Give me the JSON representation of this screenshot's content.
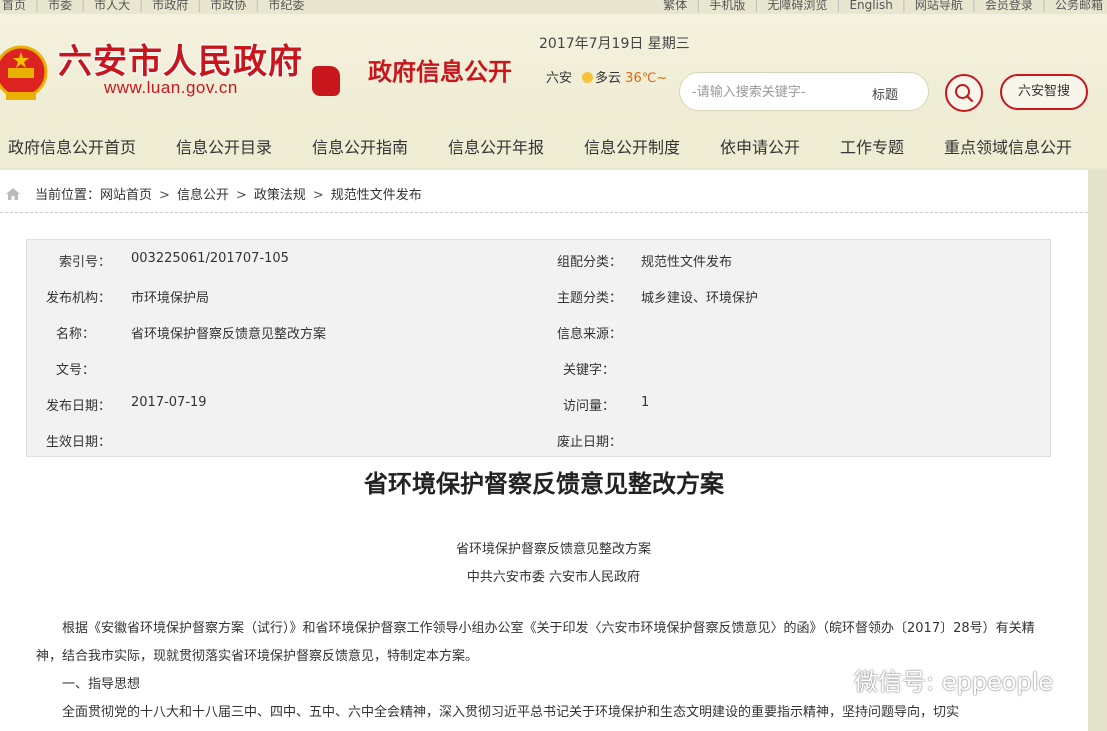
{
  "topbar": {
    "left_links": [
      "首页",
      "市委",
      "市人大",
      "市政府",
      "市政协",
      "市纪委"
    ],
    "right_links": [
      "繁体",
      "手机版",
      "无障碍浏览",
      "English",
      "网站导航",
      "会员登录",
      "公务邮箱"
    ]
  },
  "header": {
    "site_name": "六安市人民政府",
    "site_url": "www.luan.gov.cn",
    "channel_name": "政府信息公开",
    "date": "2017年7月19日 星期三",
    "weather": {
      "city": "六安",
      "condition": "多云",
      "temp": "36℃~"
    },
    "search": {
      "placeholder": "-请输入搜索关键字-",
      "scope": "标题"
    },
    "smart_search_label": "六安智搜"
  },
  "nav": {
    "items": [
      "政府信息公开首页",
      "信息公开目录",
      "信息公开指南",
      "信息公开年报",
      "信息公开制度",
      "依申请公开",
      "工作专题",
      "重点领域信息公开"
    ]
  },
  "breadcrumb": {
    "label": "当前位置：",
    "items": [
      "网站首页",
      "信息公开",
      "政策法规",
      "规范性文件发布"
    ],
    "sep": ">"
  },
  "meta": {
    "index_label": "索引号：",
    "index_value": "003225061/201707-105",
    "category_label": "组配分类：",
    "category_value": "规范性文件发布",
    "publisher_label": "发布机构：",
    "publisher_value": "市环境保护局",
    "topic_label": "主题分类：",
    "topic_value": "城乡建设、环境保护",
    "name_label": "名称：",
    "name_value": "省环境保护督察反馈意见整改方案",
    "source_label": "信息来源：",
    "source_value": "",
    "docno_label": "文号：",
    "docno_value": "",
    "keyword_label": "关键字：",
    "keyword_value": "",
    "date_label": "发布日期：",
    "date_value": "2017-07-19",
    "visits_label": "访问量：",
    "visits_value": "1",
    "effective_label": "生效日期：",
    "effective_value": "",
    "expire_label": "废止日期：",
    "expire_value": ""
  },
  "document": {
    "title": "省环境保护督察反馈意见整改方案",
    "subtitle": "省环境保护督察反馈意见整改方案",
    "issuer": "中共六安市委  六安市人民政府",
    "para1": "根据《安徽省环境保护督察方案（试行）》和省环境保护督察工作领导小组办公室《关于印发〈六安市环境保护督察反馈意见〉的函》（皖环督领办〔2017〕28号）有关精神，结合我市实际，现就贯彻落实省环境保护督察反馈意见，特制定本方案。",
    "heading1": "一、指导思想",
    "para2": "全面贯彻党的十八大和十八届三中、四中、五中、六中全会精神，深入贯彻习近平总书记关于环境保护和生态文明建设的重要指示精神，坚持问题导向，切实"
  },
  "watermark": "微信号: eppeople",
  "colors": {
    "brand_red": "#c8161d",
    "header_bg": "#efecd4",
    "meta_bg": "#f2f2f2"
  }
}
